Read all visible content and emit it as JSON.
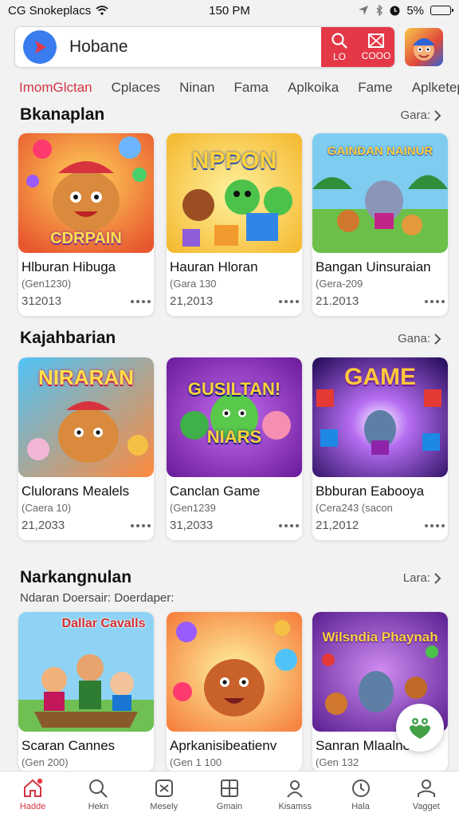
{
  "status_bar": {
    "carrier": "CG Snokeplacs",
    "time": "150 PM",
    "battery": "5%"
  },
  "search": {
    "value": "Hobane",
    "action_1_label": "LO",
    "action_2_label": "COOO"
  },
  "tabs": [
    {
      "label": "ImomGlctan",
      "active": true
    },
    {
      "label": "Cplaces"
    },
    {
      "label": "Ninan"
    },
    {
      "label": "Fama"
    },
    {
      "label": "Aplkoika"
    },
    {
      "label": "Fame"
    },
    {
      "label": "Aplketeplces"
    }
  ],
  "sections": [
    {
      "title": "Bkanaplan",
      "more": "Gara:",
      "cards": [
        {
          "name": "Hlburan Hibuga",
          "sub": "(Gen1230)",
          "date": "312013",
          "art_text": "CDRPAIN"
        },
        {
          "name": "Hauran Hloran",
          "sub": "(Gara 130",
          "date": "21,2013",
          "art_text": "NPPON"
        },
        {
          "name": "Bangan Uinsuraian",
          "sub": "(Gera-209",
          "date": "21.2013",
          "art_text": "GAINDAN NAINUR"
        }
      ]
    },
    {
      "title": "Kajahbarian",
      "more": "Gana:",
      "cards": [
        {
          "name": "Clulorans Mealels",
          "sub": "(Caera 10)",
          "date": "21,2033",
          "art_text": "NIRARAN"
        },
        {
          "name": "Canclan Game",
          "sub": "(Gen1239",
          "date": "31,2033",
          "art_text": "GUSILTAN! NIARS"
        },
        {
          "name": "Bbburan Eabooya",
          "sub": "(Cera243 (sacon",
          "date": "21,2012",
          "art_text": "GAME"
        }
      ]
    },
    {
      "title": "Narkangnulan",
      "more": "Lara:",
      "subtitle": "Ndaran Doersair: Doerdaper:",
      "cards": [
        {
          "name": "Scaran Cannes",
          "sub": "(Gen 200)",
          "art_text": "Dallar Cavalls"
        },
        {
          "name": "Aprkanisibeatienv",
          "sub": "(Gen 1 100",
          "art_text": ""
        },
        {
          "name": "Sanran Mlaalnean",
          "sub": "(Gen 132",
          "art_text": "Wilsndia Phaynah"
        }
      ]
    }
  ],
  "bottom_nav": [
    {
      "label": "Hadde",
      "icon": "home-icon",
      "active": true
    },
    {
      "label": "Hekn",
      "icon": "search-icon"
    },
    {
      "label": "Mesely",
      "icon": "games-icon"
    },
    {
      "label": "Gmain",
      "icon": "grid-icon"
    },
    {
      "label": "Kisamss",
      "icon": "person-icon"
    },
    {
      "label": "Hala",
      "icon": "timer-icon"
    },
    {
      "label": "Vagget",
      "icon": "profile-icon"
    }
  ],
  "colors": {
    "accent": "#d43541",
    "search_actions": "#e53847",
    "background": "#f2f2f3"
  }
}
